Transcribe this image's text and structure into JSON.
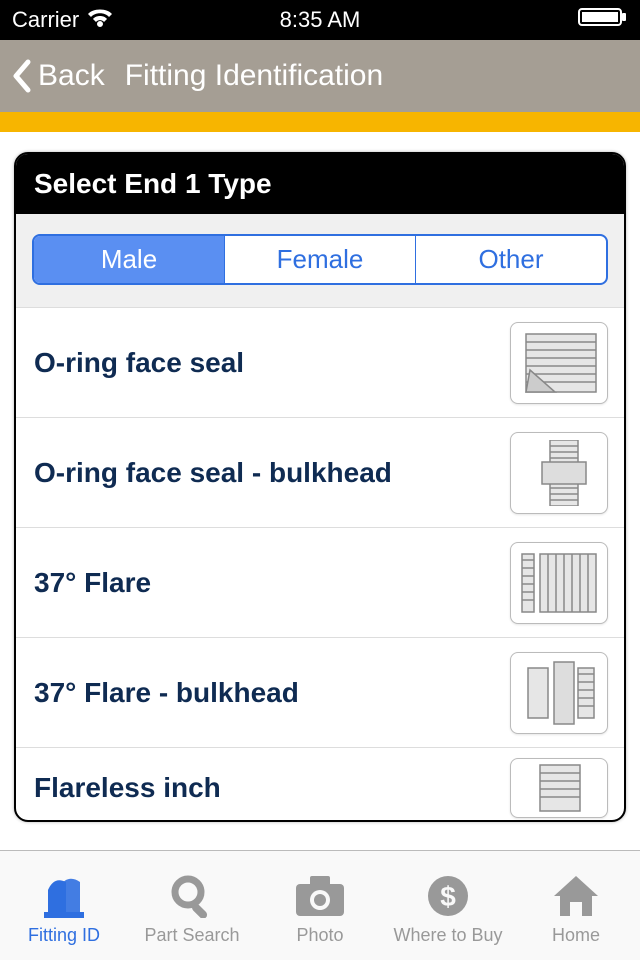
{
  "status": {
    "carrier": "Carrier",
    "time": "8:35 AM"
  },
  "nav": {
    "back_label": "Back",
    "title": "Fitting Identification"
  },
  "card": {
    "title": "Select End 1 Type"
  },
  "segments": [
    {
      "label": "Male",
      "active": true
    },
    {
      "label": "Female",
      "active": false
    },
    {
      "label": "Other",
      "active": false
    }
  ],
  "rows": [
    {
      "label": "O-ring face seal",
      "icon": "fitting-oring"
    },
    {
      "label": "O-ring face seal - bulkhead",
      "icon": "fitting-oring-bulkhead"
    },
    {
      "label": "37° Flare",
      "icon": "fitting-37flare"
    },
    {
      "label": "37° Flare - bulkhead",
      "icon": "fitting-37flare-bulkhead"
    },
    {
      "label": "Flareless inch",
      "icon": "fitting-flareless"
    }
  ],
  "tabs": [
    {
      "label": "Fitting ID",
      "icon": "fitting-id-icon",
      "active": true
    },
    {
      "label": "Part Search",
      "icon": "search-icon",
      "active": false
    },
    {
      "label": "Photo",
      "icon": "camera-icon",
      "active": false
    },
    {
      "label": "Where to Buy",
      "icon": "dollar-icon",
      "active": false
    },
    {
      "label": "Home",
      "icon": "home-icon",
      "active": false
    }
  ]
}
